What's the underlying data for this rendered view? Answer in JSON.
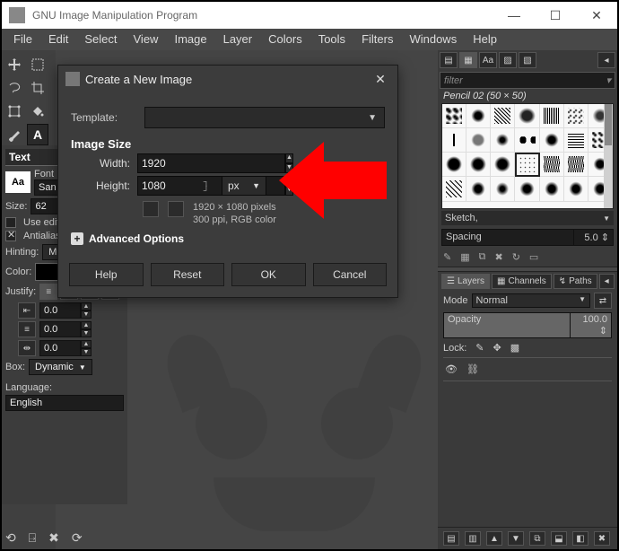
{
  "window": {
    "title": "GNU Image Manipulation Program",
    "min": "—",
    "max": "☐",
    "close": "✕"
  },
  "menu": [
    "File",
    "Edit",
    "Select",
    "View",
    "Image",
    "Layer",
    "Colors",
    "Tools",
    "Filters",
    "Windows",
    "Help"
  ],
  "left_options": {
    "section": "Text",
    "font_label": "Font",
    "font_value": "San",
    "aa_swatch": "Aa",
    "size_label": "Size:",
    "size_value": "62",
    "use_edit": "Use edit",
    "antialias": "Antialias",
    "hinting_label": "Hinting:",
    "hinting_value": "Medium",
    "color_label": "Color:",
    "justify_label": "Justify:",
    "indent_a": "0.0",
    "indent_b": "0.0",
    "indent_c": "0.0",
    "box_label": "Box:",
    "box_value": "Dynamic",
    "language_label": "Language:",
    "language_value": "English"
  },
  "dialog": {
    "title": "Create a New Image",
    "template_label": "Template:",
    "section": "Image Size",
    "width_label": "Width:",
    "width_value": "1920",
    "height_label": "Height:",
    "height_value": "1080",
    "unit": "px",
    "info_line1": "1920 × 1080 pixels",
    "info_line2": "300 ppi, RGB color",
    "advanced": "Advanced Options",
    "help": "Help",
    "reset": "Reset",
    "ok": "OK",
    "cancel": "Cancel"
  },
  "right": {
    "filter_placeholder": "filter",
    "brush_name": "Pencil 02 (50 × 50)",
    "sketch": "Sketch,",
    "spacing_label": "Spacing",
    "spacing_value": "5.0",
    "tab_layers": "Layers",
    "tab_channels": "Channels",
    "tab_paths": "Paths",
    "mode_label": "Mode",
    "mode_value": "Normal",
    "opacity_label": "Opacity",
    "opacity_value": "100.0",
    "lock_label": "Lock:"
  }
}
